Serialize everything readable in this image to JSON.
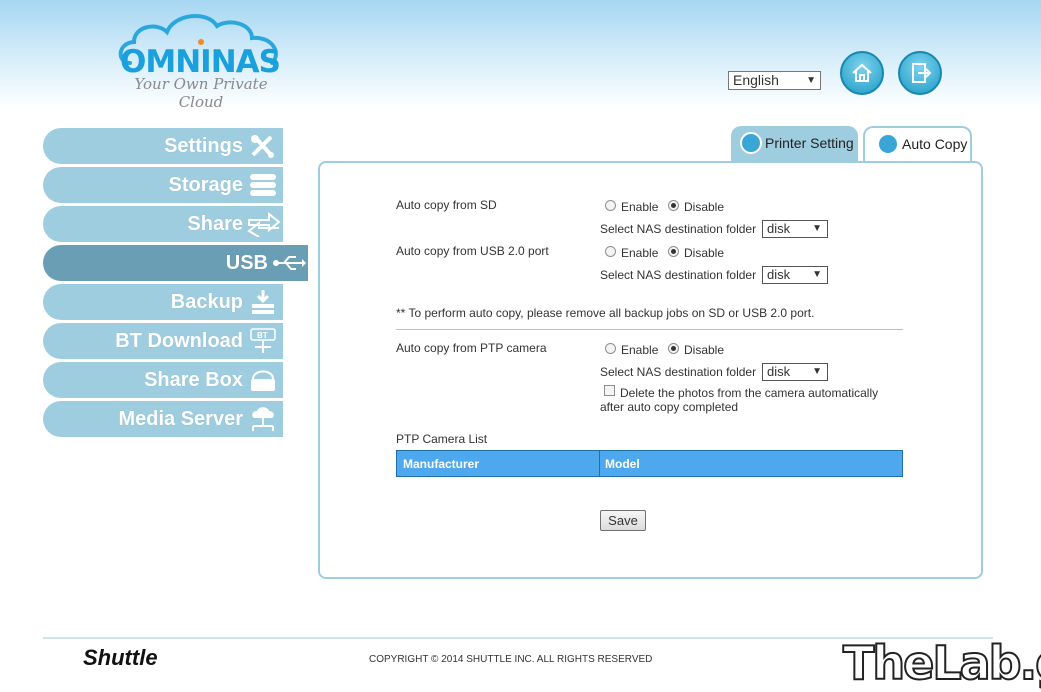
{
  "logo": {
    "word": "OMNINAS",
    "tagline": "Your Own Private Cloud"
  },
  "header": {
    "language": "English",
    "home_icon": "home-icon",
    "logout_icon": "logout-icon"
  },
  "sidebar": {
    "items": [
      {
        "label": "Settings",
        "icon": "tools-icon"
      },
      {
        "label": "Storage",
        "icon": "storage-icon"
      },
      {
        "label": "Share",
        "icon": "share-arrows-icon"
      },
      {
        "label": "USB",
        "icon": "usb-icon",
        "active": true
      },
      {
        "label": "Backup",
        "icon": "backup-icon"
      },
      {
        "label": "BT Download",
        "icon": "bt-icon",
        "icon_text": "BT"
      },
      {
        "label": "Share Box",
        "icon": "sharebox-icon"
      },
      {
        "label": "Media Server",
        "icon": "media-server-icon"
      }
    ]
  },
  "tabs": [
    {
      "label": "Printer Setting",
      "icon": "printer-icon"
    },
    {
      "label": "Auto Copy",
      "icon": "auto-copy-icon",
      "active": true
    }
  ],
  "form": {
    "sd": {
      "label": "Auto copy from SD",
      "enable": "Enable",
      "disable": "Disable",
      "selected": "Disable",
      "folder_label": "Select NAS destination folder",
      "folder_value": "disk"
    },
    "usb": {
      "label": "Auto copy from USB 2.0 port",
      "enable": "Enable",
      "disable": "Disable",
      "selected": "Disable",
      "folder_label": "Select NAS destination folder",
      "folder_value": "disk"
    },
    "note": "** To perform auto copy, please remove all backup jobs on SD or USB 2.0 port.",
    "ptp": {
      "label": "Auto copy from PTP camera",
      "enable": "Enable",
      "disable": "Disable",
      "selected": "Disable",
      "folder_label": "Select NAS destination folder",
      "folder_value": "disk",
      "delete_line1": "Delete the photos from the camera automatically",
      "delete_line2": "after auto copy completed",
      "delete_checked": false
    },
    "ptp_list": {
      "title": "PTP Camera List",
      "columns": [
        "Manufacturer",
        "Model"
      ]
    },
    "save_label": "Save"
  },
  "footer": {
    "brand": "Shuttle",
    "copyright": "COPYRIGHT © 2014 SHUTTLE INC. ALL RIGHTS RESERVED",
    "watermark": "TheLab.gr"
  },
  "colors": {
    "sidebar": "#9fcde0",
    "sidebar_active": "#6a9eb4",
    "accent": "#1aa0dc",
    "table_header": "#4ea8ee"
  }
}
